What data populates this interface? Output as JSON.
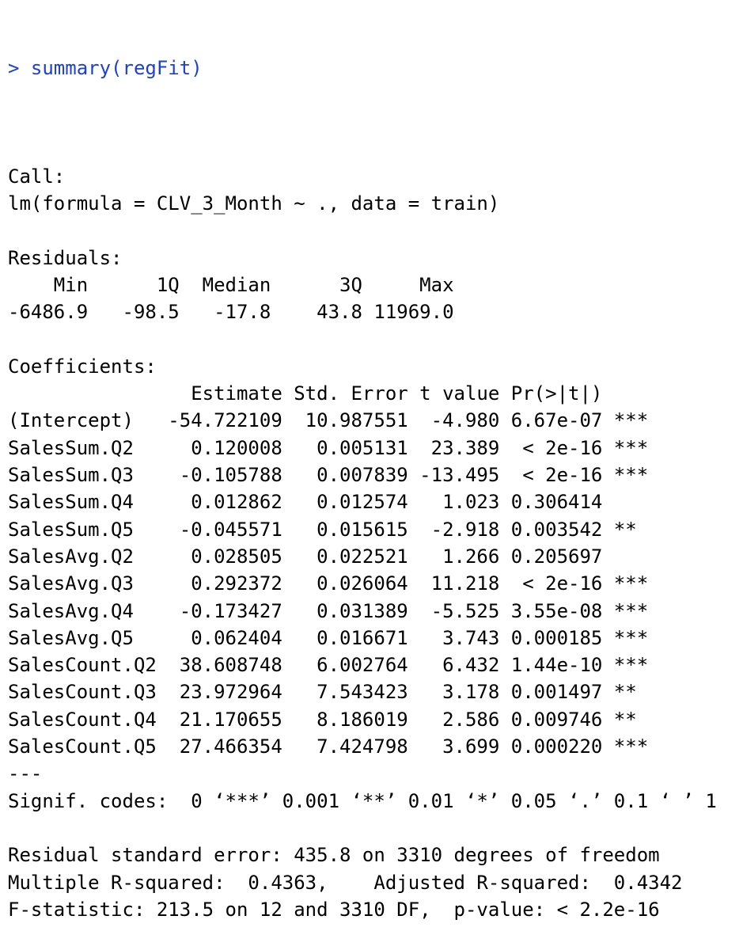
{
  "console": {
    "prompt_symbol": ">",
    "command": "summary(regFit)",
    "prompt_color": "#1c3fd4",
    "output_lines": [
      "",
      "Call:",
      "lm(formula = CLV_3_Month ~ ., data = train)",
      "",
      "Residuals:",
      "    Min      1Q  Median      3Q     Max ",
      "-6486.9   -98.5   -17.8    43.8 11969.0 ",
      "",
      "Coefficients:",
      "                Estimate Std. Error t value Pr(>|t|)    ",
      "(Intercept)   -54.722109  10.987551  -4.980 6.67e-07 ***",
      "SalesSum.Q2     0.120008   0.005131  23.389  < 2e-16 ***",
      "SalesSum.Q3    -0.105788   0.007839 -13.495  < 2e-16 ***",
      "SalesSum.Q4     0.012862   0.012574   1.023 0.306414    ",
      "SalesSum.Q5    -0.045571   0.015615  -2.918 0.003542 ** ",
      "SalesAvg.Q2     0.028505   0.022521   1.266 0.205697    ",
      "SalesAvg.Q3     0.292372   0.026064  11.218  < 2e-16 ***",
      "SalesAvg.Q4    -0.173427   0.031389  -5.525 3.55e-08 ***",
      "SalesAvg.Q5     0.062404   0.016671   3.743 0.000185 ***",
      "SalesCount.Q2  38.608748   6.002764   6.432 1.44e-10 ***",
      "SalesCount.Q3  23.972964   7.543423   3.178 0.001497 ** ",
      "SalesCount.Q4  21.170655   8.186019   2.586 0.009746 ** ",
      "SalesCount.Q5  27.466354   7.424798   3.699 0.000220 ***",
      "---",
      "Signif. codes:  0 ‘***’ 0.001 ‘**’ 0.01 ‘*’ 0.05 ‘.’ 0.1 ‘ ’ 1",
      "",
      "Residual standard error: 435.8 on 3310 degrees of freedom",
      "Multiple R-squared:  0.4363,\tAdjusted R-squared:  0.4342 ",
      "F-statistic: 213.5 on 12 and 3310 DF,  p-value: < 2.2e-16"
    ]
  }
}
